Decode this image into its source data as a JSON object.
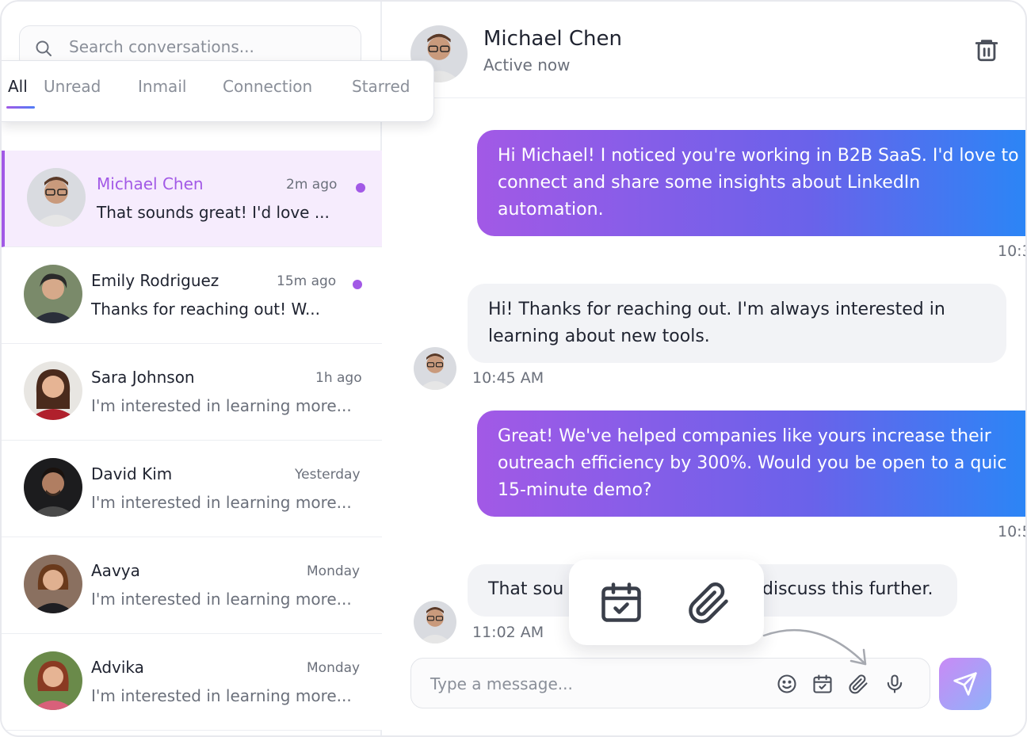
{
  "search": {
    "placeholder": "Search conversations..."
  },
  "tabs": [
    {
      "label": "All",
      "active": true
    },
    {
      "label": "Unread"
    },
    {
      "label": "Inmail"
    },
    {
      "label": "Connection"
    },
    {
      "label": "Starred"
    }
  ],
  "conversations": [
    {
      "name": "Michael Chen",
      "time": "2m ago",
      "preview": "That sounds great! I'd love ...",
      "unread": true,
      "active": true
    },
    {
      "name": "Emily Rodriguez",
      "time": "15m ago",
      "preview": "Thanks for reaching out! W...",
      "unread": true
    },
    {
      "name": "Sara Johnson",
      "time": "1h ago",
      "preview": "I'm interested in learning more..."
    },
    {
      "name": "David Kim",
      "time": "Yesterday",
      "preview": "I'm interested in learning more..."
    },
    {
      "name": "Aavya",
      "time": "Monday",
      "preview": "I'm interested in learning more..."
    },
    {
      "name": "Advika",
      "time": "Monday",
      "preview": "I'm interested in learning more..."
    }
  ],
  "chat": {
    "contact_name": "Michael Chen",
    "status": "Active now",
    "messages": [
      {
        "type": "sent",
        "lines": [
          "Hi Michael! I noticed you're working in B2B SaaS. I'd love to",
          "connect and share some insights about LinkedIn",
          "automation."
        ],
        "time": "10:3"
      },
      {
        "type": "received",
        "lines": [
          "Hi! Thanks for reaching out. I'm always interested in",
          "learning about new tools."
        ],
        "time": "10:45 AM"
      },
      {
        "type": "sent",
        "lines": [
          "Great! We've helped companies like yours increase their",
          "outreach efficiency by 300%. Would you be open to a quic",
          "15-minute demo?"
        ],
        "time": "10:5"
      },
      {
        "type": "received",
        "lines": [
          "That sou",
          "discuss this further."
        ],
        "time": "11:02 AM"
      }
    ]
  },
  "composer": {
    "placeholder": "Type a message..."
  },
  "icons": {
    "search": "search-icon",
    "trash": "trash-icon",
    "emoji": "emoji-icon",
    "calendar": "calendar-icon",
    "attachment": "paperclip-icon",
    "mic": "microphone-icon",
    "send": "send-icon"
  },
  "colors": {
    "accent": "#a259e6",
    "blue": "#2a86f6",
    "unread_dot": "#a259e6"
  }
}
